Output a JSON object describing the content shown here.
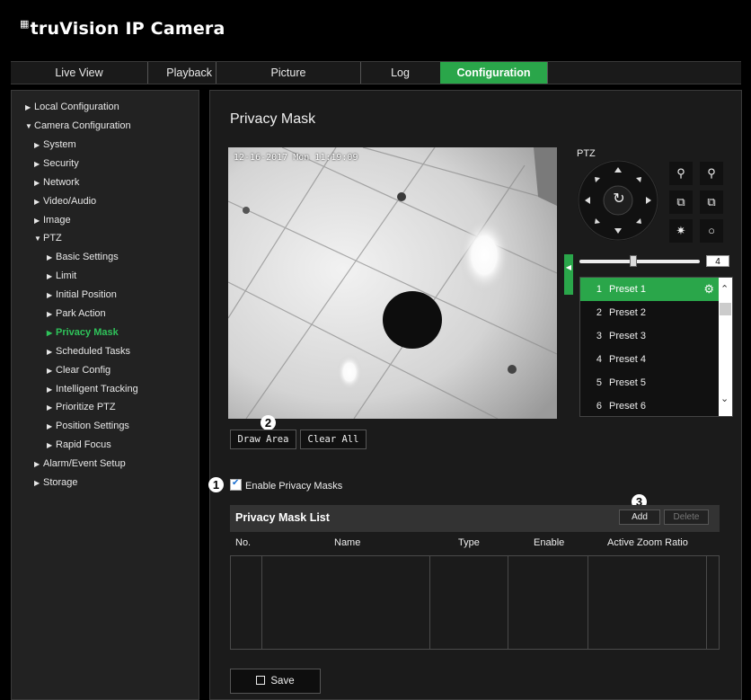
{
  "app": {
    "brand_mark": "tru",
    "brand_title": "truVision  IP Camera"
  },
  "tabs": [
    {
      "label": "Live View"
    },
    {
      "label": "Playback"
    },
    {
      "label": "Picture"
    },
    {
      "label": "Log"
    },
    {
      "label": "Configuration",
      "active": true
    }
  ],
  "sidebar": {
    "items": [
      {
        "label": "Local Configuration",
        "expanded": false
      },
      {
        "label": "Camera Configuration",
        "expanded": true
      },
      {
        "label": "System"
      },
      {
        "label": "Security"
      },
      {
        "label": "Network"
      },
      {
        "label": "Video/Audio"
      },
      {
        "label": "Image"
      },
      {
        "label": "PTZ",
        "expanded": true
      },
      {
        "label": "Basic Settings"
      },
      {
        "label": "Limit"
      },
      {
        "label": "Initial Position"
      },
      {
        "label": "Park Action"
      },
      {
        "label": "Privacy Mask",
        "active": true
      },
      {
        "label": "Scheduled Tasks"
      },
      {
        "label": "Clear Config"
      },
      {
        "label": "Intelligent Tracking"
      },
      {
        "label": "Prioritize PTZ"
      },
      {
        "label": "Position Settings"
      },
      {
        "label": "Rapid Focus"
      },
      {
        "label": "Alarm/Event Setup"
      },
      {
        "label": "Storage"
      }
    ]
  },
  "main": {
    "title": "Privacy Mask",
    "video_osd": "12-16-2017 Mon 11:19:09",
    "draw_area_label": "Draw Area",
    "clear_all_label": "Clear All",
    "enable_label": "Enable Privacy Masks",
    "enable_checked": true,
    "list": {
      "title": "Privacy Mask List",
      "add_label": "Add",
      "delete_label": "Delete",
      "columns": [
        "No.",
        "Name",
        "Type",
        "Enable",
        "Active Zoom Ratio"
      ],
      "rows": []
    },
    "save_label": "Save"
  },
  "callouts": [
    "1",
    "2",
    "3"
  ],
  "ptz": {
    "label": "PTZ",
    "speed": "4",
    "speed_fraction": 0.45,
    "presets": [
      {
        "num": "1",
        "name": "Preset 1",
        "selected": true
      },
      {
        "num": "2",
        "name": "Preset 2"
      },
      {
        "num": "3",
        "name": "Preset 3"
      },
      {
        "num": "4",
        "name": "Preset 4"
      },
      {
        "num": "5",
        "name": "Preset 5"
      },
      {
        "num": "6",
        "name": "Preset 6"
      }
    ]
  },
  "colors": {
    "accent": "#2aa64a",
    "background": "#000000",
    "panel": "#1b1b1b"
  },
  "icons": [
    "zoom-in-icon",
    "zoom-out-icon",
    "focus-near-icon",
    "focus-far-icon",
    "iris-open-icon",
    "iris-close-icon",
    "auto-pan-icon",
    "gear-icon",
    "save-icon"
  ]
}
